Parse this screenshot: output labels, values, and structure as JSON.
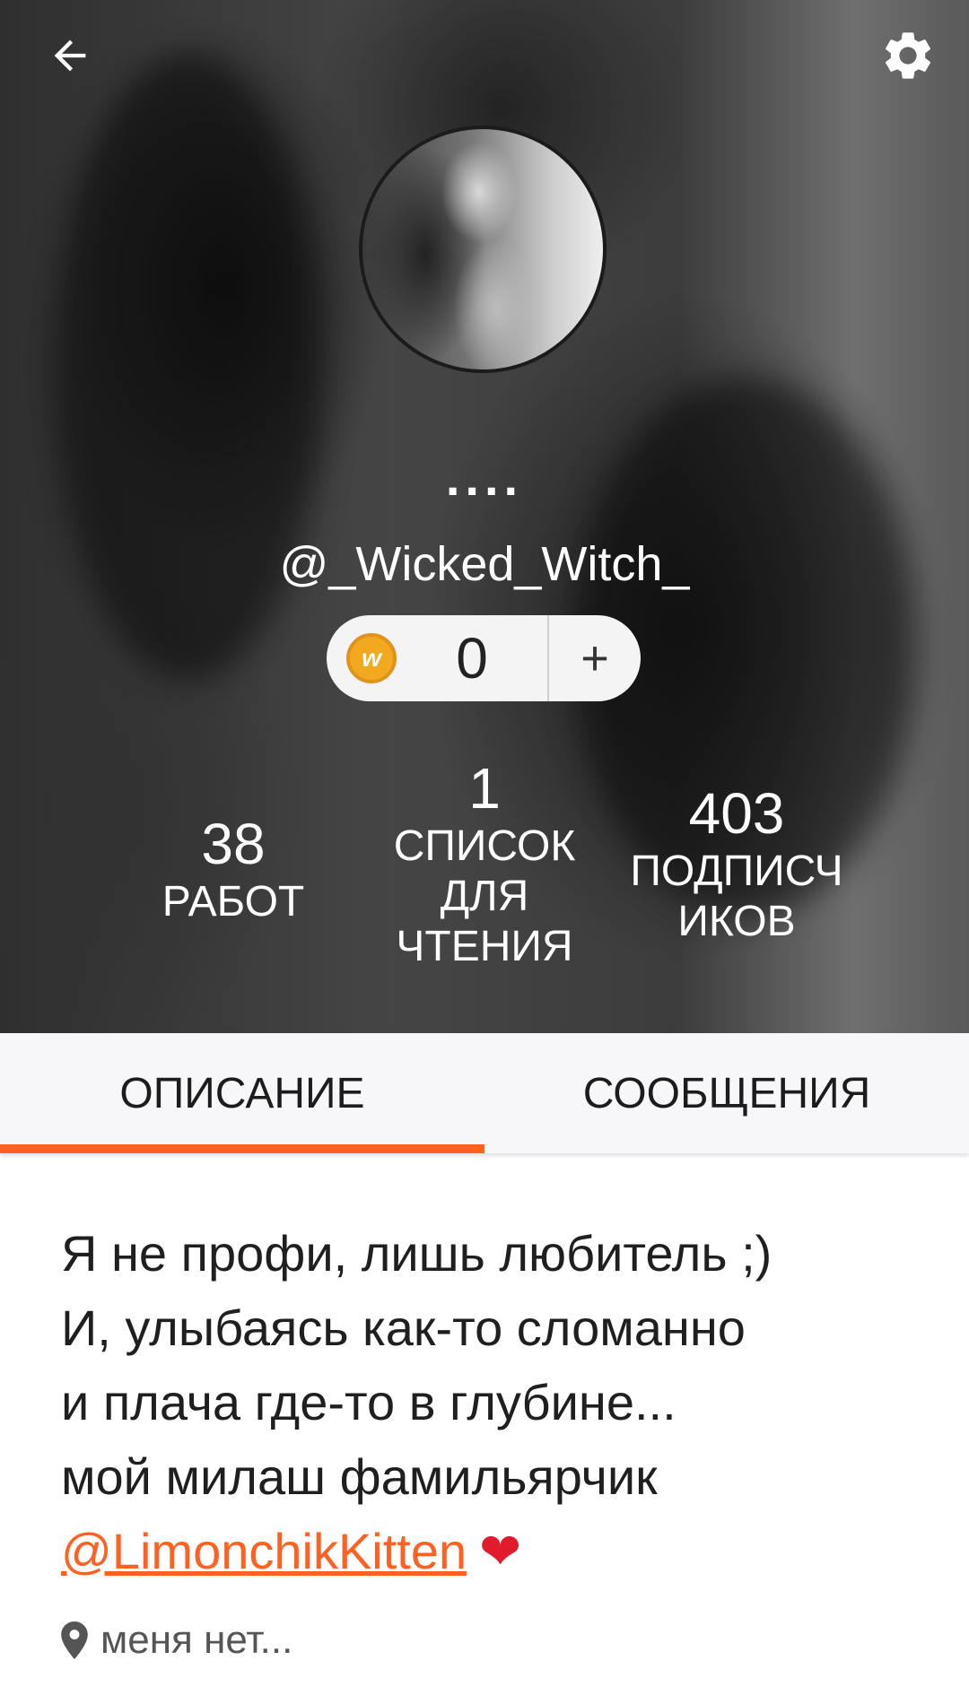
{
  "header": {
    "display_name": "....",
    "username": "@_Wicked_Witch_",
    "coins": {
      "icon": "wattpad-coin-icon",
      "count": "0",
      "add_label": "+"
    },
    "stats": {
      "works": {
        "value": "38",
        "label": "РАБОТ"
      },
      "reading_lists": {
        "value": "1",
        "label_line1": "СПИСОК",
        "label_line2": "ДЛЯ",
        "label_line3": "ЧТЕНИЯ"
      },
      "followers": {
        "value": "403",
        "label_line1": "ПОДПИСЧ",
        "label_line2": "ИКОВ"
      }
    }
  },
  "tabs": [
    {
      "label": "ОПИСАНИЕ",
      "active": true
    },
    {
      "label": "СООБЩЕНИЯ",
      "active": false
    }
  ],
  "about": {
    "line1": "Я не профи, лишь любитель ;)",
    "line2": "И, улыбаясь как-то сломанно",
    "line3": "и плача где-то в глубине...",
    "line4": "мой милаш фамильярчик",
    "mention": "@LimonchikKitten",
    "emoji": "❤"
  },
  "location": {
    "icon": "location-pin-icon",
    "text": "меня нет..."
  },
  "colors": {
    "accent": "#ff6122",
    "coin": "#f2a91f",
    "heart": "#e11b2b"
  }
}
